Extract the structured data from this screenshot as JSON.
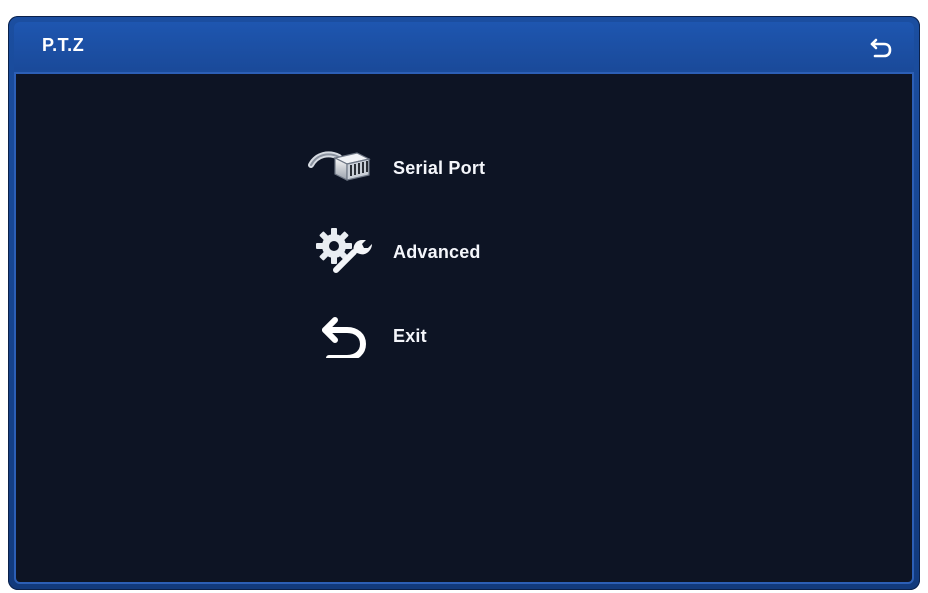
{
  "window": {
    "title": "P.T.Z",
    "back_icon": "return-arrow-icon"
  },
  "menu": {
    "items": [
      {
        "label": "Serial Port",
        "icon": "serial-port-icon"
      },
      {
        "label": "Advanced",
        "icon": "gear-wrench-icon"
      },
      {
        "label": "Exit",
        "icon": "return-arrow-icon"
      }
    ]
  },
  "colors": {
    "frame": "#1b4ea0",
    "content_bg": "#0d1424",
    "border": "#2c5fb6",
    "text": "#ffffff"
  }
}
